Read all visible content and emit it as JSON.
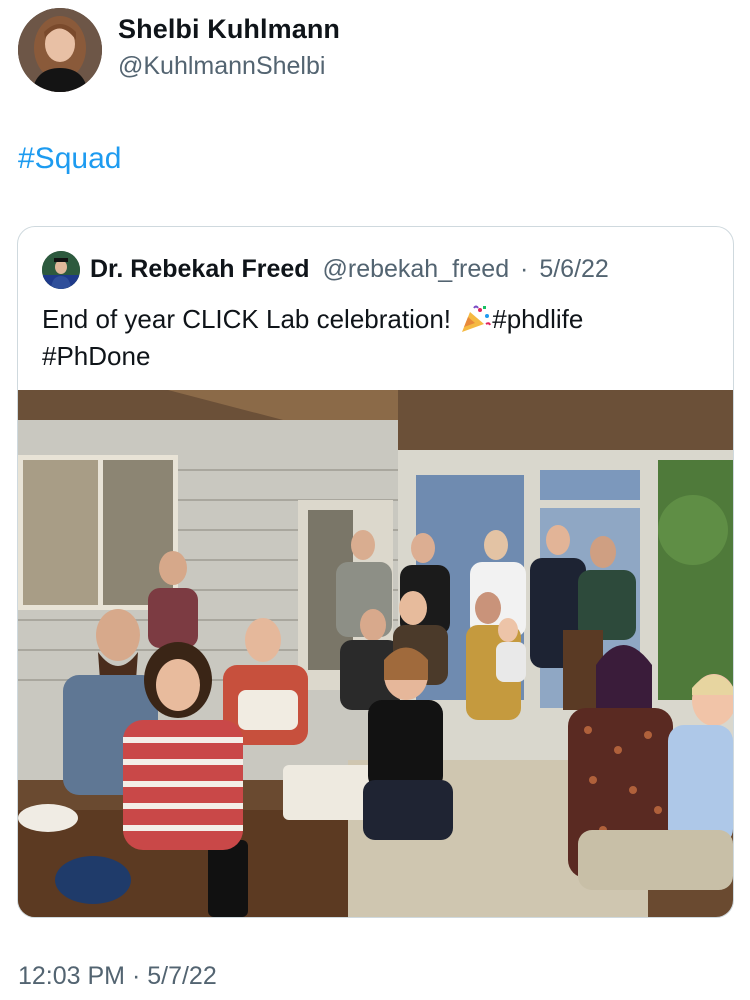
{
  "author": {
    "display_name": "Shelbi Kuhlmann",
    "handle": "@KuhlmannShelbi",
    "avatar_icon": "profile-photo"
  },
  "tweet": {
    "text": "#Squad",
    "timestamp": "12:03 PM · 5/7/22"
  },
  "quoted_tweet": {
    "display_name": "Dr. Rebekah Freed",
    "handle": "@rebekah_freed",
    "separator": "·",
    "date": "5/6/22",
    "text_part1": "End of year CLICK Lab celebration! ",
    "emoji": "party-popper-icon",
    "text_tag1": "#phdlife",
    "text_tag2": "#PhDone",
    "photo_description_icon": "group-photo"
  },
  "colors": {
    "link": "#1d9bf0",
    "secondary_text": "#536471",
    "border": "#cfd9de"
  }
}
